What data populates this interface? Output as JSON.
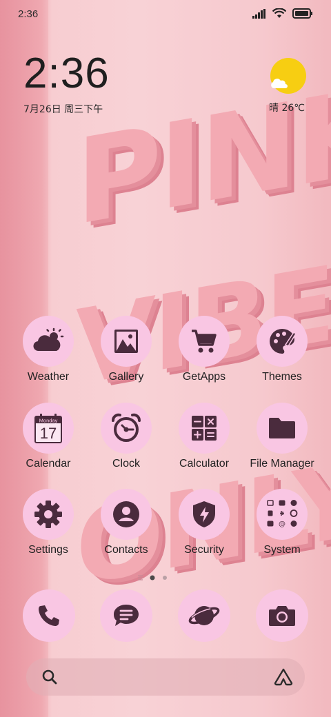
{
  "status_bar": {
    "time": "2:36"
  },
  "clock_widget": {
    "time": "2:36",
    "date": "7月26日 周三下午"
  },
  "weather_widget": {
    "text": "晴 26℃",
    "icon": "partly-sunny-icon"
  },
  "wallpaper": {
    "lines": [
      "PINK",
      "VIBES",
      "ONLY"
    ]
  },
  "apps": [
    {
      "label": "Weather",
      "icon": "weather-icon"
    },
    {
      "label": "Gallery",
      "icon": "gallery-icon"
    },
    {
      "label": "GetApps",
      "icon": "cart-icon"
    },
    {
      "label": "Themes",
      "icon": "palette-icon"
    },
    {
      "label": "Calendar",
      "icon": "calendar-icon",
      "day_label": "Monday",
      "day_number": "17"
    },
    {
      "label": "Clock",
      "icon": "alarm-clock-icon"
    },
    {
      "label": "Calculator",
      "icon": "calculator-icon"
    },
    {
      "label": "File Manager",
      "icon": "folder-icon"
    },
    {
      "label": "Settings",
      "icon": "gear-icon"
    },
    {
      "label": "Contacts",
      "icon": "contact-icon"
    },
    {
      "label": "Security",
      "icon": "shield-icon"
    },
    {
      "label": "System",
      "icon": "system-folder-icon"
    }
  ],
  "dock": [
    {
      "icon": "phone-icon"
    },
    {
      "icon": "message-icon"
    },
    {
      "icon": "browser-planet-icon"
    },
    {
      "icon": "camera-icon"
    }
  ],
  "page_indicator": {
    "pages": 2,
    "current": 1
  },
  "search_bar": {
    "icon": "search-icon",
    "assistant_icon": "assistant-icon"
  },
  "colors": {
    "icon_bg": "#f9c6e3",
    "icon_fg": "#4a2b3d",
    "sun": "#f7ce12"
  }
}
